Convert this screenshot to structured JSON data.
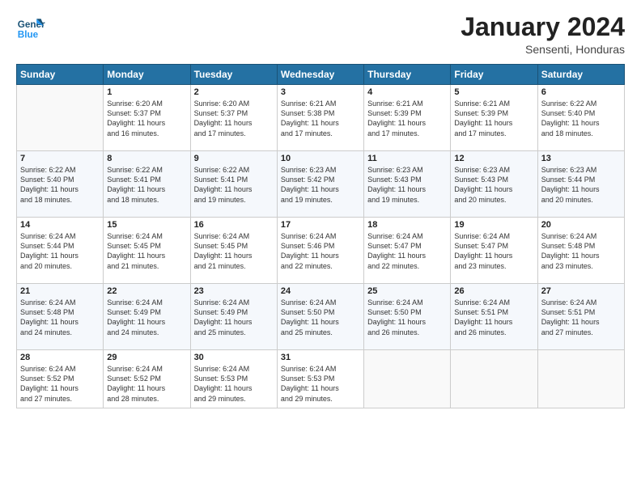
{
  "logo": {
    "general": "General",
    "blue": "Blue"
  },
  "header": {
    "month": "January 2024",
    "location": "Sensenti, Honduras"
  },
  "days_of_week": [
    "Sunday",
    "Monday",
    "Tuesday",
    "Wednesday",
    "Thursday",
    "Friday",
    "Saturday"
  ],
  "weeks": [
    [
      {
        "day": "",
        "info": ""
      },
      {
        "day": "1",
        "info": "Sunrise: 6:20 AM\nSunset: 5:37 PM\nDaylight: 11 hours\nand 16 minutes."
      },
      {
        "day": "2",
        "info": "Sunrise: 6:20 AM\nSunset: 5:37 PM\nDaylight: 11 hours\nand 17 minutes."
      },
      {
        "day": "3",
        "info": "Sunrise: 6:21 AM\nSunset: 5:38 PM\nDaylight: 11 hours\nand 17 minutes."
      },
      {
        "day": "4",
        "info": "Sunrise: 6:21 AM\nSunset: 5:39 PM\nDaylight: 11 hours\nand 17 minutes."
      },
      {
        "day": "5",
        "info": "Sunrise: 6:21 AM\nSunset: 5:39 PM\nDaylight: 11 hours\nand 17 minutes."
      },
      {
        "day": "6",
        "info": "Sunrise: 6:22 AM\nSunset: 5:40 PM\nDaylight: 11 hours\nand 18 minutes."
      }
    ],
    [
      {
        "day": "7",
        "info": "Sunrise: 6:22 AM\nSunset: 5:40 PM\nDaylight: 11 hours\nand 18 minutes."
      },
      {
        "day": "8",
        "info": "Sunrise: 6:22 AM\nSunset: 5:41 PM\nDaylight: 11 hours\nand 18 minutes."
      },
      {
        "day": "9",
        "info": "Sunrise: 6:22 AM\nSunset: 5:41 PM\nDaylight: 11 hours\nand 19 minutes."
      },
      {
        "day": "10",
        "info": "Sunrise: 6:23 AM\nSunset: 5:42 PM\nDaylight: 11 hours\nand 19 minutes."
      },
      {
        "day": "11",
        "info": "Sunrise: 6:23 AM\nSunset: 5:43 PM\nDaylight: 11 hours\nand 19 minutes."
      },
      {
        "day": "12",
        "info": "Sunrise: 6:23 AM\nSunset: 5:43 PM\nDaylight: 11 hours\nand 20 minutes."
      },
      {
        "day": "13",
        "info": "Sunrise: 6:23 AM\nSunset: 5:44 PM\nDaylight: 11 hours\nand 20 minutes."
      }
    ],
    [
      {
        "day": "14",
        "info": "Sunrise: 6:24 AM\nSunset: 5:44 PM\nDaylight: 11 hours\nand 20 minutes."
      },
      {
        "day": "15",
        "info": "Sunrise: 6:24 AM\nSunset: 5:45 PM\nDaylight: 11 hours\nand 21 minutes."
      },
      {
        "day": "16",
        "info": "Sunrise: 6:24 AM\nSunset: 5:45 PM\nDaylight: 11 hours\nand 21 minutes."
      },
      {
        "day": "17",
        "info": "Sunrise: 6:24 AM\nSunset: 5:46 PM\nDaylight: 11 hours\nand 22 minutes."
      },
      {
        "day": "18",
        "info": "Sunrise: 6:24 AM\nSunset: 5:47 PM\nDaylight: 11 hours\nand 22 minutes."
      },
      {
        "day": "19",
        "info": "Sunrise: 6:24 AM\nSunset: 5:47 PM\nDaylight: 11 hours\nand 23 minutes."
      },
      {
        "day": "20",
        "info": "Sunrise: 6:24 AM\nSunset: 5:48 PM\nDaylight: 11 hours\nand 23 minutes."
      }
    ],
    [
      {
        "day": "21",
        "info": "Sunrise: 6:24 AM\nSunset: 5:48 PM\nDaylight: 11 hours\nand 24 minutes."
      },
      {
        "day": "22",
        "info": "Sunrise: 6:24 AM\nSunset: 5:49 PM\nDaylight: 11 hours\nand 24 minutes."
      },
      {
        "day": "23",
        "info": "Sunrise: 6:24 AM\nSunset: 5:49 PM\nDaylight: 11 hours\nand 25 minutes."
      },
      {
        "day": "24",
        "info": "Sunrise: 6:24 AM\nSunset: 5:50 PM\nDaylight: 11 hours\nand 25 minutes."
      },
      {
        "day": "25",
        "info": "Sunrise: 6:24 AM\nSunset: 5:50 PM\nDaylight: 11 hours\nand 26 minutes."
      },
      {
        "day": "26",
        "info": "Sunrise: 6:24 AM\nSunset: 5:51 PM\nDaylight: 11 hours\nand 26 minutes."
      },
      {
        "day": "27",
        "info": "Sunrise: 6:24 AM\nSunset: 5:51 PM\nDaylight: 11 hours\nand 27 minutes."
      }
    ],
    [
      {
        "day": "28",
        "info": "Sunrise: 6:24 AM\nSunset: 5:52 PM\nDaylight: 11 hours\nand 27 minutes."
      },
      {
        "day": "29",
        "info": "Sunrise: 6:24 AM\nSunset: 5:52 PM\nDaylight: 11 hours\nand 28 minutes."
      },
      {
        "day": "30",
        "info": "Sunrise: 6:24 AM\nSunset: 5:53 PM\nDaylight: 11 hours\nand 29 minutes."
      },
      {
        "day": "31",
        "info": "Sunrise: 6:24 AM\nSunset: 5:53 PM\nDaylight: 11 hours\nand 29 minutes."
      },
      {
        "day": "",
        "info": ""
      },
      {
        "day": "",
        "info": ""
      },
      {
        "day": "",
        "info": ""
      }
    ]
  ]
}
